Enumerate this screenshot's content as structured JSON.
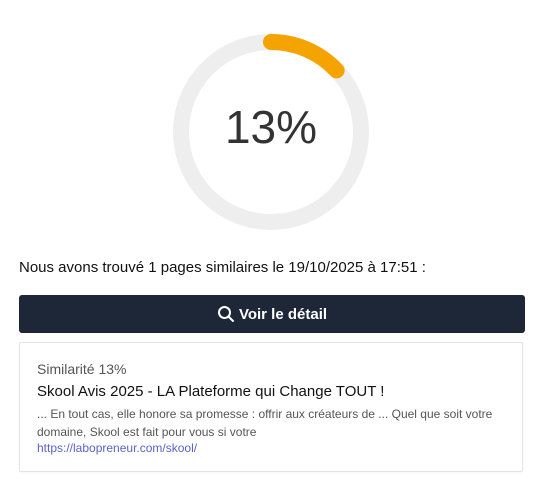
{
  "gauge": {
    "percent_label": "13%",
    "value_fraction": 0.13,
    "track_color": "#eeeeee",
    "fill_color": "#f5a300"
  },
  "summary_text": "Nous avons trouvé 1 pages similaires le 19/10/2025 à 17:51 :",
  "detail_button": {
    "label": "Voir le détail",
    "icon": "search-icon",
    "bg_color": "#1e2738"
  },
  "results": [
    {
      "similarity": "Similarité 13%",
      "title": "Skool Avis 2025 - LA Plateforme qui Change TOUT !",
      "snippet": "... En tout cas, elle honore sa promesse : offrir aux créateurs de ... Quel que soit votre domaine, Skool est fait pour vous si votre",
      "url": "https://labopreneur.com/skool/",
      "link_color": "#5b62c9"
    }
  ]
}
